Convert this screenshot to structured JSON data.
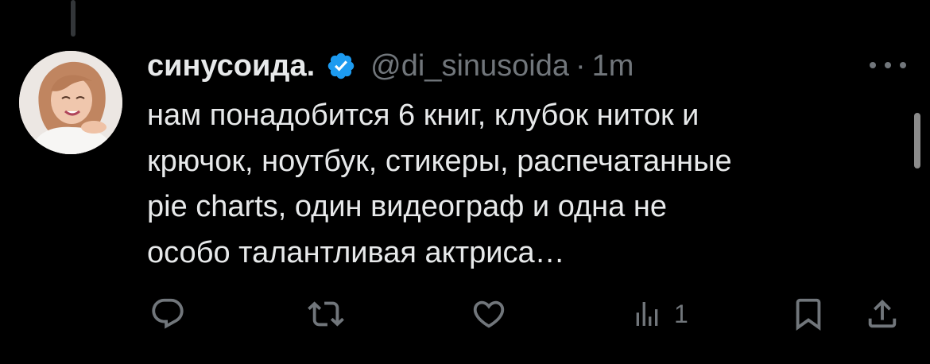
{
  "tweet": {
    "author_name": "синусоида.",
    "handle": "@di_sinusoida",
    "separator": "·",
    "time": "1m",
    "verified": true,
    "text": "нам понадобится 6 книг, клубок ниток и\nкрючок, ноутбук, стикеры, распечатанные\npie charts, один видеограф и одна не\nособо талантливая актриса…"
  },
  "actions": {
    "reply_icon": "reply-icon",
    "retweet_icon": "retweet-icon",
    "like_icon": "like-icon",
    "views_icon": "views-icon",
    "views_count": "1",
    "bookmark_icon": "bookmark-icon",
    "share_icon": "share-icon"
  },
  "colors": {
    "background": "#000000",
    "text_primary": "#e7e9ea",
    "text_secondary": "#71767b",
    "verified_badge": "#1d9bf0",
    "thread_line": "#333639"
  }
}
